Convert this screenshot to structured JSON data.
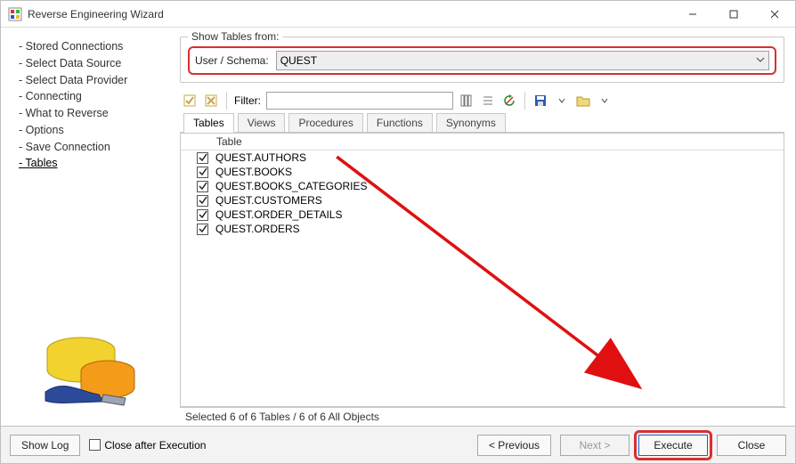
{
  "window": {
    "title": "Reverse Engineering Wizard"
  },
  "sidebar": {
    "steps": [
      {
        "label": "- Stored Connections",
        "current": false
      },
      {
        "label": "- Select Data Source",
        "current": false
      },
      {
        "label": "- Select Data Provider",
        "current": false
      },
      {
        "label": "- Connecting",
        "current": false
      },
      {
        "label": "- What to Reverse",
        "current": false
      },
      {
        "label": "- Options",
        "current": false
      },
      {
        "label": "- Save Connection",
        "current": false
      },
      {
        "label": "- Tables",
        "current": true
      }
    ]
  },
  "group": {
    "legend": "Show Tables from:",
    "schema_label": "User / Schema:",
    "schema_value": "QUEST"
  },
  "toolbar": {
    "filter_label": "Filter:",
    "filter_value": ""
  },
  "tabs": [
    {
      "label": "Tables",
      "active": true
    },
    {
      "label": "Views",
      "active": false
    },
    {
      "label": "Procedures",
      "active": false
    },
    {
      "label": "Functions",
      "active": false
    },
    {
      "label": "Synonyms",
      "active": false
    }
  ],
  "table": {
    "header": "Table",
    "rows": [
      {
        "checked": true,
        "name": "QUEST.AUTHORS"
      },
      {
        "checked": true,
        "name": "QUEST.BOOKS"
      },
      {
        "checked": true,
        "name": "QUEST.BOOKS_CATEGORIES"
      },
      {
        "checked": true,
        "name": "QUEST.CUSTOMERS"
      },
      {
        "checked": true,
        "name": "QUEST.ORDER_DETAILS"
      },
      {
        "checked": true,
        "name": "QUEST.ORDERS"
      }
    ]
  },
  "status": "Selected 6 of 6 Tables / 6 of 6 All Objects",
  "bottom": {
    "show_log": "Show Log",
    "close_after": "Close after Execution",
    "previous": "< Previous",
    "next": "Next >",
    "execute": "Execute",
    "close": "Close"
  }
}
